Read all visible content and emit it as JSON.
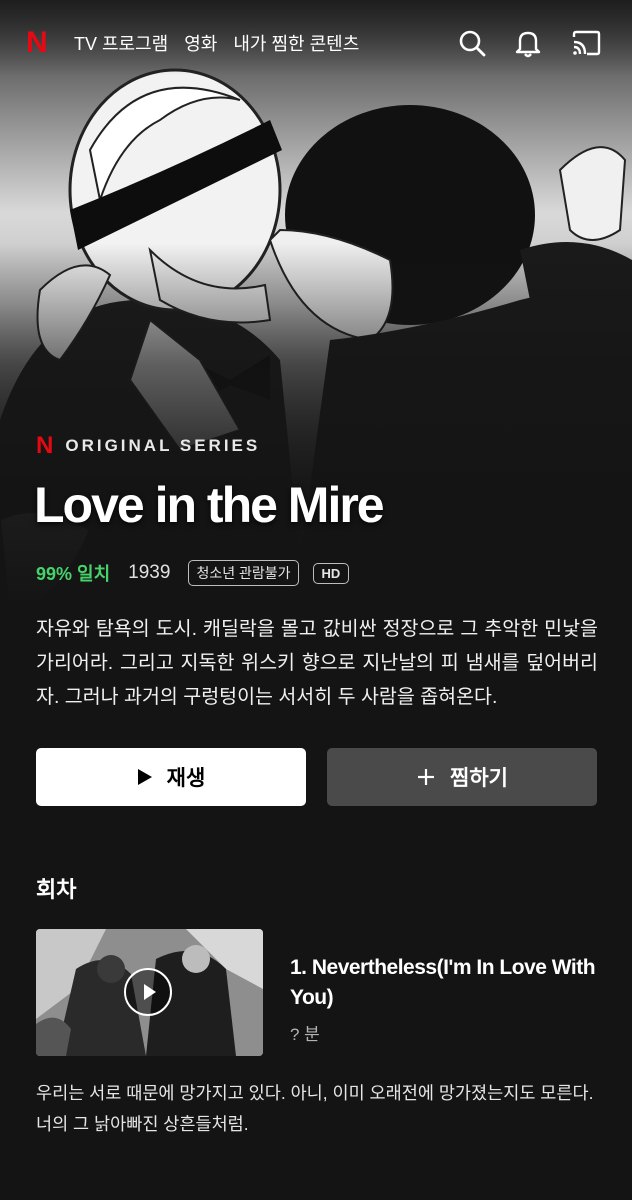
{
  "nav": {
    "logo": "N",
    "links": [
      "TV 프로그램",
      "영화",
      "내가 찜한 콘텐츠"
    ],
    "icons": [
      "search-icon",
      "bell-icon",
      "cast-icon"
    ]
  },
  "show": {
    "series_logo": "N",
    "series_label": "ORIGINAL SERIES",
    "title": "Love in the Mire",
    "match": "99% 일치",
    "year": "1939",
    "rating": "청소년 관람불가",
    "quality": "HD",
    "synopsis": "자유와 탐욕의 도시. 캐딜락을 몰고 값비싼 정장으로 그 추악한 민낯을 가리어라. 그리고 지독한 위스키 향으로 지난날의 피 냄새를 덮어버리자. 그러나 과거의 구렁텅이는 서서히 두 사람을 좁혀온다."
  },
  "actions": {
    "play_label": "재생",
    "play_icon": "play-icon",
    "mylist_label": "찜하기",
    "mylist_icon": "plus-icon"
  },
  "episodes": {
    "section_title": "회차",
    "items": [
      {
        "title": "1. Nevertheless(I'm In Love With You)",
        "duration": "? 분",
        "description": "우리는 서로 때문에 망가지고 있다. 아니, 이미 오래전에 망가졌는지도 모른다. 너의 그 낡아빠진 상흔들처럼."
      }
    ]
  },
  "colors": {
    "background": "#141414",
    "netflix_red": "#e50914",
    "match_green": "#46d369",
    "secondary_button": "#4a4a4a"
  }
}
